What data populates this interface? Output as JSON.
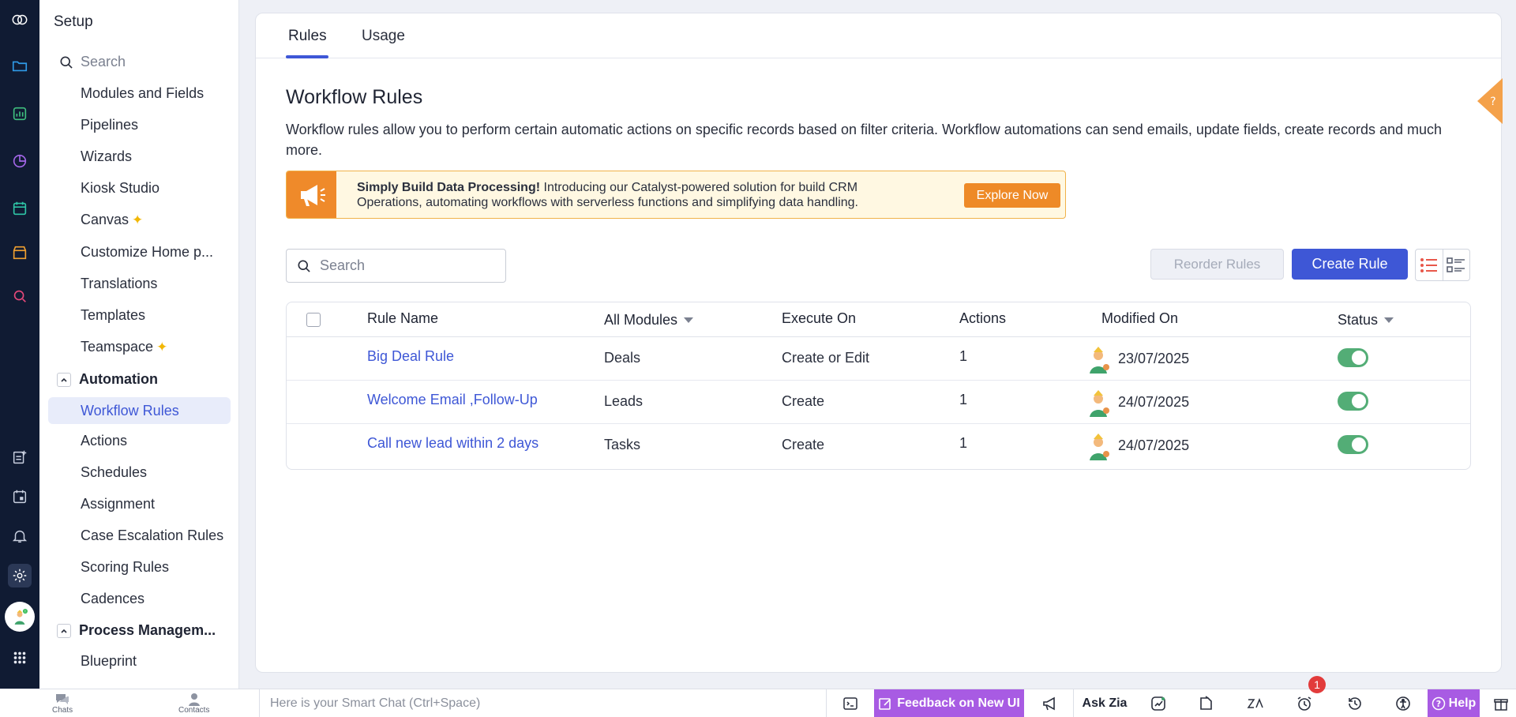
{
  "sidebar": {
    "title": "Setup",
    "search_placeholder": "Search",
    "items": [
      {
        "label": "Modules and Fields"
      },
      {
        "label": "Pipelines"
      },
      {
        "label": "Wizards"
      },
      {
        "label": "Kiosk Studio"
      },
      {
        "label": "Canvas"
      },
      {
        "label": "Customize Home p..."
      },
      {
        "label": "Translations"
      },
      {
        "label": "Templates"
      },
      {
        "label": "Teamspace"
      }
    ],
    "automation_group": "Automation",
    "automation_items": [
      {
        "label": "Workflow Rules"
      },
      {
        "label": "Actions"
      },
      {
        "label": "Schedules"
      },
      {
        "label": "Assignment"
      },
      {
        "label": "Case Escalation Rules"
      },
      {
        "label": "Scoring Rules"
      },
      {
        "label": "Cadences"
      }
    ],
    "process_group": "Process Managem...",
    "process_items": [
      {
        "label": "Blueprint"
      }
    ]
  },
  "tabs": [
    {
      "label": "Rules"
    },
    {
      "label": "Usage"
    }
  ],
  "page": {
    "title": "Workflow Rules",
    "description": "Workflow rules allow you to perform certain automatic actions on specific records based on filter criteria. Workflow automations can send emails, update fields, create records and much more."
  },
  "banner": {
    "bold": "Simply Build Data Processing!",
    "text": " Introducing our Catalyst-powered solution for build CRM Operations, automating workflows with serverless functions and simplifying data handling.",
    "button": "Explore Now"
  },
  "toolbar": {
    "search_placeholder": "Search",
    "reorder_label": "Reorder Rules",
    "create_label": "Create Rule"
  },
  "table": {
    "headers": {
      "rule_name": "Rule Name",
      "module": "All Modules",
      "execute_on": "Execute On",
      "actions": "Actions",
      "modified_on": "Modified On",
      "status": "Status"
    },
    "rows": [
      {
        "name": "Big Deal Rule",
        "module": "Deals",
        "execute_on": "Create or Edit",
        "actions": "1",
        "modified_on": "23/07/2025",
        "status": "on"
      },
      {
        "name": "Welcome Email ,Follow-Up",
        "module": "Leads",
        "execute_on": "Create",
        "actions": "1",
        "modified_on": "24/07/2025",
        "status": "on"
      },
      {
        "name": "Call new lead within 2 days",
        "module": "Tasks",
        "execute_on": "Create",
        "actions": "1",
        "modified_on": "24/07/2025",
        "status": "on"
      }
    ]
  },
  "bottombar": {
    "chats": "Chats",
    "contacts": "Contacts",
    "smart_chat_placeholder": "Here is your Smart Chat (Ctrl+Space)",
    "feedback": "Feedback on New UI",
    "ask_zia": "Ask Zia",
    "notification_count": "1",
    "help": "Help"
  },
  "colors": {
    "accent": "#3e57d6",
    "rail": "#101b33",
    "banner_orange": "#ef8a2a",
    "toggle_on": "#53ad76",
    "feedback_purple": "#a85be3"
  }
}
